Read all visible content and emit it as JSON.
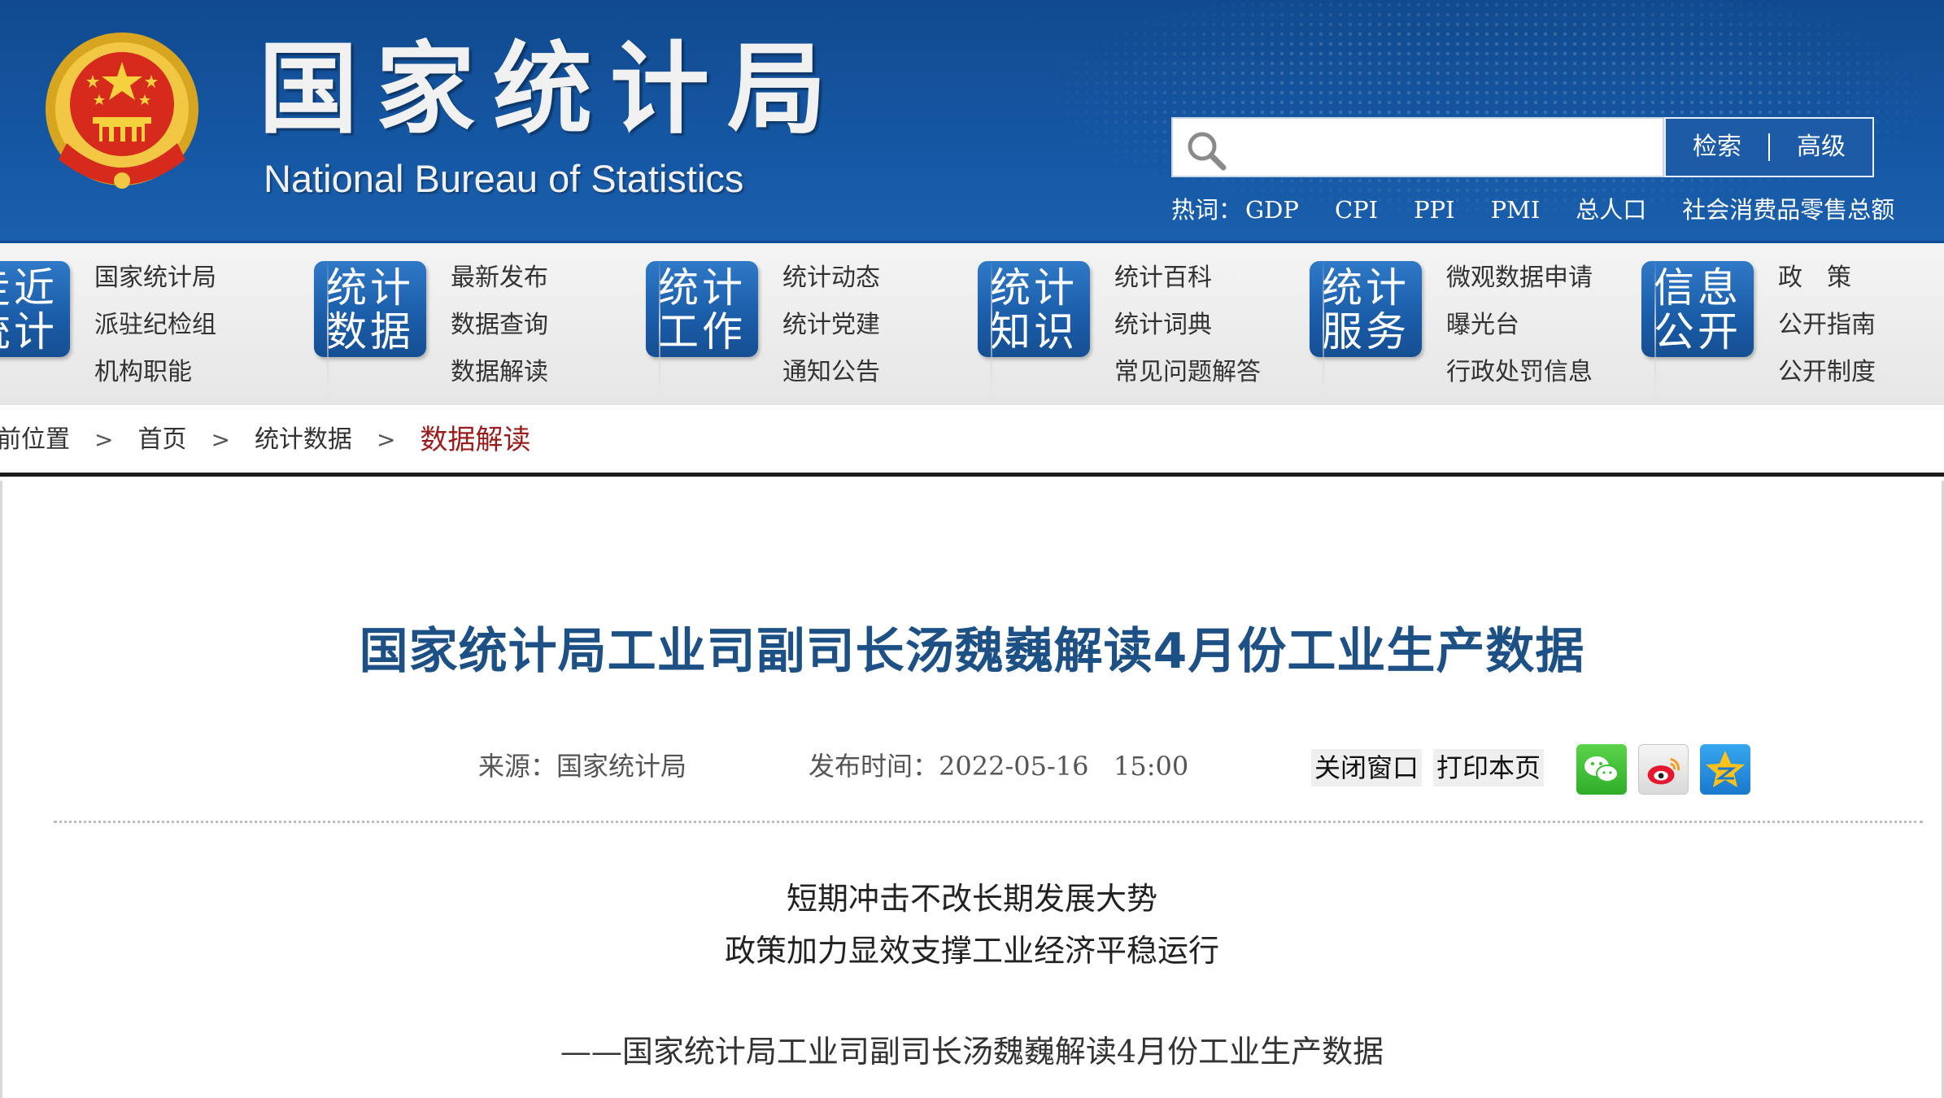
{
  "header": {
    "title_cn": "国家统计局",
    "title_en": "National Bureau of Statistics",
    "search": {
      "placeholder": "",
      "search_label": "检索",
      "advanced_label": "高级"
    },
    "hotwords_label": "热词：",
    "hotwords": [
      "GDP",
      "CPI",
      "PPI",
      "PMI",
      "总人口",
      "社会消费品零售总额"
    ]
  },
  "nav": {
    "groups": [
      {
        "tile": [
          "走近",
          "统计"
        ],
        "links": [
          "国家统计局",
          "派驻纪检组",
          "机构职能"
        ]
      },
      {
        "tile": [
          "统计",
          "数据"
        ],
        "links": [
          "最新发布",
          "数据查询",
          "数据解读"
        ]
      },
      {
        "tile": [
          "统计",
          "工作"
        ],
        "links": [
          "统计动态",
          "统计党建",
          "通知公告"
        ]
      },
      {
        "tile": [
          "统计",
          "知识"
        ],
        "links": [
          "统计百科",
          "统计词典",
          "常见问题解答"
        ]
      },
      {
        "tile": [
          "统计",
          "服务"
        ],
        "links": [
          "微观数据申请",
          "曝光台",
          "行政处罚信息"
        ]
      },
      {
        "tile": [
          "信息",
          "公开"
        ],
        "links": [
          "政　策",
          "公开指南",
          "公开制度"
        ]
      }
    ]
  },
  "breadcrumb": {
    "lead": "前位置",
    "items": [
      "首页",
      "统计数据"
    ],
    "current": "数据解读",
    "separator": ">"
  },
  "article": {
    "title": "国家统计局工业司副司长汤魏巍解读4月份工业生产数据",
    "source": "来源：国家统计局",
    "published": "发布时间：2022-05-16   15:00",
    "close_label": "关闭窗口",
    "print_label": "打印本页",
    "subheads": [
      "短期冲击不改长期发展大势",
      "政策加力显效支撑工业经济平稳运行",
      "——国家统计局工业司副司长汤魏巍解读4月份工业生产数据"
    ]
  },
  "colors": {
    "header_blue": "#1556a2",
    "title_blue": "#1d5185",
    "breadcrumb_current": "#9b1c1c"
  }
}
